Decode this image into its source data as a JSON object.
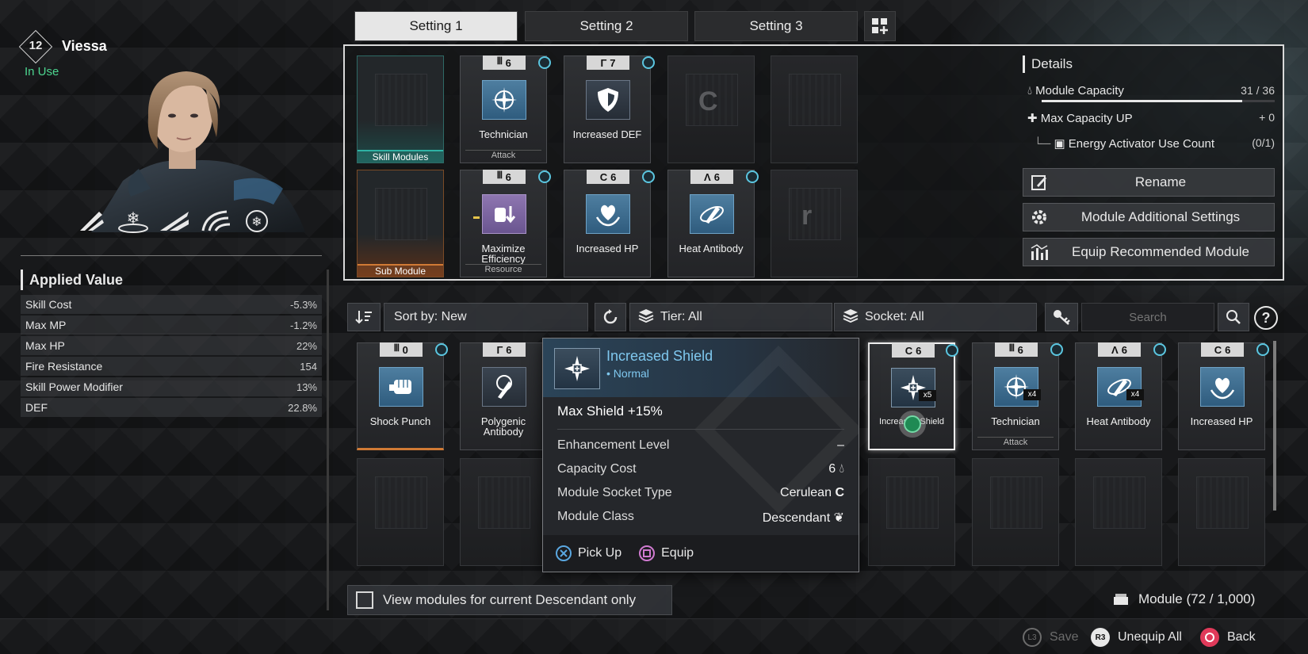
{
  "character": {
    "level": "12",
    "name": "Viessa",
    "status": "In Use",
    "skill_icons": [
      "ice-shard-icon",
      "snowflake-icon",
      "blizzard-icon",
      "frost-wave-icon",
      "frost-orb-icon"
    ]
  },
  "applied_value": {
    "title": "Applied Value",
    "rows": [
      {
        "label": "Skill Cost",
        "value": "-5.3%"
      },
      {
        "label": "Max MP",
        "value": "-1.2%"
      },
      {
        "label": "Max HP",
        "value": "22%"
      },
      {
        "label": "Fire Resistance",
        "value": "154"
      },
      {
        "label": "Skill Power Modifier",
        "value": "13%"
      },
      {
        "label": "DEF",
        "value": "22.8%"
      }
    ]
  },
  "tabs": [
    "Setting 1",
    "Setting 2",
    "Setting 3"
  ],
  "equipped": {
    "skill_label": "Skill Modules",
    "sub_label": "Sub Module",
    "row1": [
      {
        "tier": "6",
        "name": "Technician",
        "sub": "Attack",
        "icon": "crosshair-icon"
      },
      {
        "tier": "7",
        "name": "Increased DEF",
        "sub": "",
        "icon": "shield-icon"
      }
    ],
    "row1_socket_symbol": "C",
    "row2": [
      {
        "tier": "6",
        "name": "Maximize Efficiency",
        "sub": "Resource",
        "icon": "efficiency-icon"
      },
      {
        "tier": "6",
        "name": "Increased HP",
        "sub": "",
        "icon": "heart-hands-icon"
      },
      {
        "tier": "6",
        "name": "Heat Antibody",
        "sub": "",
        "icon": "antibody-icon"
      }
    ],
    "row2_socket_symbol": "r"
  },
  "details": {
    "title": "Details",
    "module_capacity_label": "Module Capacity",
    "module_capacity_value": "31 / 36",
    "capacity_fraction": 0.861,
    "max_capacity_label": "Max Capacity UP",
    "max_capacity_value": "+ 0",
    "energy_label": "Energy Activator Use Count",
    "energy_value": "(0/1)"
  },
  "actions": {
    "rename": "Rename",
    "additional": "Module Additional Settings",
    "recommended": "Equip Recommended Module"
  },
  "toolbar": {
    "sort": "Sort by: New",
    "tier": "Tier: All",
    "socket": "Socket: All",
    "search_placeholder": "Search"
  },
  "inventory": [
    {
      "tier": "0",
      "name": "Shock Punch",
      "sub": "",
      "count": ""
    },
    {
      "tier": "6",
      "name": "Polygenic Antibody",
      "sub": "",
      "count": ""
    },
    {
      "tier": "6",
      "name": "Increased Shield",
      "sub": "",
      "count": "x5"
    },
    {
      "tier": "6",
      "name": "Technician",
      "sub": "Attack",
      "count": "x4"
    },
    {
      "tier": "6",
      "name": "Heat Antibody",
      "sub": "",
      "count": "x4"
    },
    {
      "tier": "6",
      "name": "Increased HP",
      "sub": "",
      "count": ""
    }
  ],
  "tooltip": {
    "name": "Increased Shield",
    "tier": "• Normal",
    "effect": "Max Shield +15%",
    "rows": [
      {
        "label": "Enhancement Level",
        "value": "–"
      },
      {
        "label": "Capacity Cost",
        "value": "6"
      },
      {
        "label": "Module Socket Type",
        "value": "Cerulean"
      },
      {
        "label": "Module Class",
        "value": "Descendant"
      }
    ],
    "pickup": "Pick Up",
    "equip": "Equip"
  },
  "footer": {
    "checkbox_label": "View modules for current Descendant only",
    "module_count": "Module (72 / 1,000)",
    "save_key": "L3",
    "save": "Save",
    "unequip_key": "R3",
    "unequip": "Unequip All",
    "back": "Back"
  },
  "colors": {
    "accent_green": "#4cd58f",
    "skill_teal": "#2fb3a5",
    "sub_orange": "#d07a35",
    "tooltip_blue": "#7fc8ef"
  }
}
